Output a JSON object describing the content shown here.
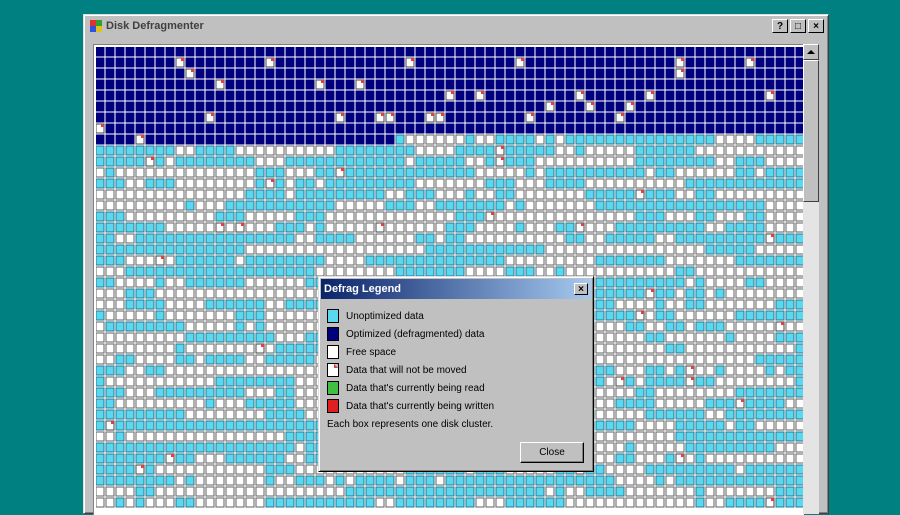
{
  "window": {
    "title": "Disk Defragmenter",
    "controls": {
      "help": "?",
      "restore": "□",
      "close": "×"
    }
  },
  "colors": {
    "desktop": "#008080",
    "unoptimized": "#5ad8f0",
    "optimized": "#00007f",
    "free": "#ffffff",
    "unmovable_mark": "#e04040",
    "reading": "#40c040",
    "writing": "#e02020"
  },
  "cluster_map": {
    "columns": 71,
    "rows": 42,
    "optimized_rows": 8,
    "optimized_partial_row_columns": 30,
    "description_icon": "cluster-grid"
  },
  "legend_dialog": {
    "title": "Defrag Legend",
    "close_glyph": "×",
    "items": [
      {
        "label": "Unoptimized data",
        "swatch": "unoptimized"
      },
      {
        "label": "Optimized (defragmented) data",
        "swatch": "optimized"
      },
      {
        "label": "Free space",
        "swatch": "free"
      },
      {
        "label": "Data that will not be moved",
        "swatch": "unmovable"
      },
      {
        "label": "Data that's currently being read",
        "swatch": "reading"
      },
      {
        "label": "Data that's currently being written",
        "swatch": "writing"
      }
    ],
    "note": "Each box represents one disk cluster.",
    "close_button": "Close"
  }
}
